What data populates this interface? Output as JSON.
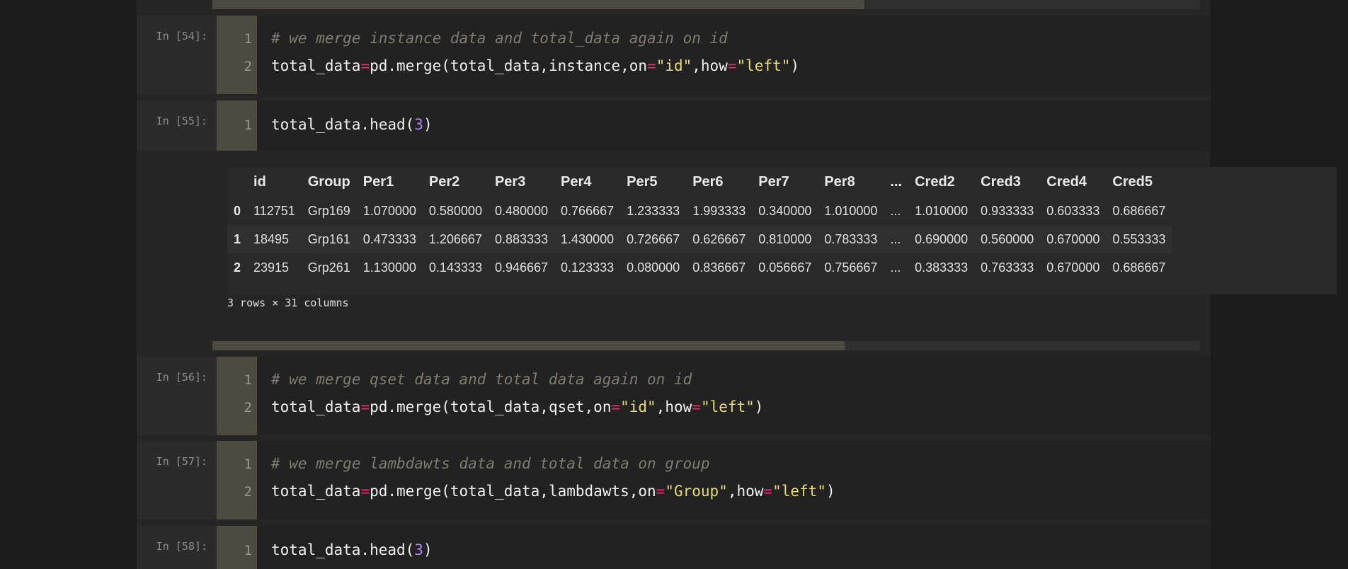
{
  "cells": [
    {
      "prompt": "In [54]:",
      "lines": [
        {
          "no": "1",
          "comment": "# we merge instance data and total_data again on id"
        },
        {
          "no": "2",
          "lhs": "total_data",
          "eq": "=",
          "call": "pd.merge(total_data,instance,on",
          "eq2": "=",
          "s1": "\"id\"",
          "mid": ",how",
          "eq3": "=",
          "s2": "\"left\"",
          "end": ")"
        }
      ]
    },
    {
      "prompt": "In [55]:",
      "lines": [
        {
          "no": "1",
          "pre": "total_data.head(",
          "num": "3",
          "end": ")"
        }
      ]
    },
    {
      "prompt": "In [56]:",
      "lines": [
        {
          "no": "1",
          "comment": "# we merge qset data and total data again on id"
        },
        {
          "no": "2",
          "lhs": "total_data",
          "eq": "=",
          "call": "pd.merge(total_data,qset,on",
          "eq2": "=",
          "s1": "\"id\"",
          "mid": ",how",
          "eq3": "=",
          "s2": "\"left\"",
          "end": ")"
        }
      ]
    },
    {
      "prompt": "In [57]:",
      "lines": [
        {
          "no": "1",
          "comment": "# we merge lambdawts data and total data on group"
        },
        {
          "no": "2",
          "lhs": "total_data",
          "eq": "=",
          "call": "pd.merge(total_data,lambdawts,on",
          "eq2": "=",
          "s1": "\"Group\"",
          "mid": ",how",
          "eq3": "=",
          "s2": "\"left\"",
          "end": ")"
        }
      ]
    },
    {
      "prompt": "In [58]:",
      "lines": [
        {
          "no": "1",
          "pre": "total_data.head(",
          "num": "3",
          "end": ")"
        }
      ]
    }
  ],
  "dataframe": {
    "columns": [
      "",
      "id",
      "Group",
      "Per1",
      "Per2",
      "Per3",
      "Per4",
      "Per5",
      "Per6",
      "Per7",
      "Per8",
      "...",
      "Cred2",
      "Cred3",
      "Cred4",
      "Cred5"
    ],
    "rows": [
      [
        "0",
        "112751",
        "Grp169",
        "1.070000",
        "0.580000",
        "0.480000",
        "0.766667",
        "1.233333",
        "1.993333",
        "0.340000",
        "1.010000",
        "...",
        "1.010000",
        "0.933333",
        "0.603333",
        "0.686667"
      ],
      [
        "1",
        "18495",
        "Grp161",
        "0.473333",
        "1.206667",
        "0.883333",
        "1.430000",
        "0.726667",
        "0.626667",
        "0.810000",
        "0.783333",
        "...",
        "0.690000",
        "0.560000",
        "0.670000",
        "0.553333"
      ],
      [
        "2",
        "23915",
        "Grp261",
        "1.130000",
        "0.143333",
        "0.946667",
        "0.123333",
        "0.080000",
        "0.836667",
        "0.056667",
        "0.756667",
        "...",
        "0.383333",
        "0.763333",
        "0.670000",
        "0.686667"
      ]
    ],
    "shape": "3 rows × 31 columns"
  },
  "scrollbars": {
    "top_thumb_fraction": 0.66,
    "output_thumb_fraction": 0.64
  },
  "colors": {
    "comment": "#7d7d72",
    "string": "#e6db74",
    "number": "#ae81ff",
    "operator": "#f92672",
    "gutter": "#4b4b40"
  }
}
